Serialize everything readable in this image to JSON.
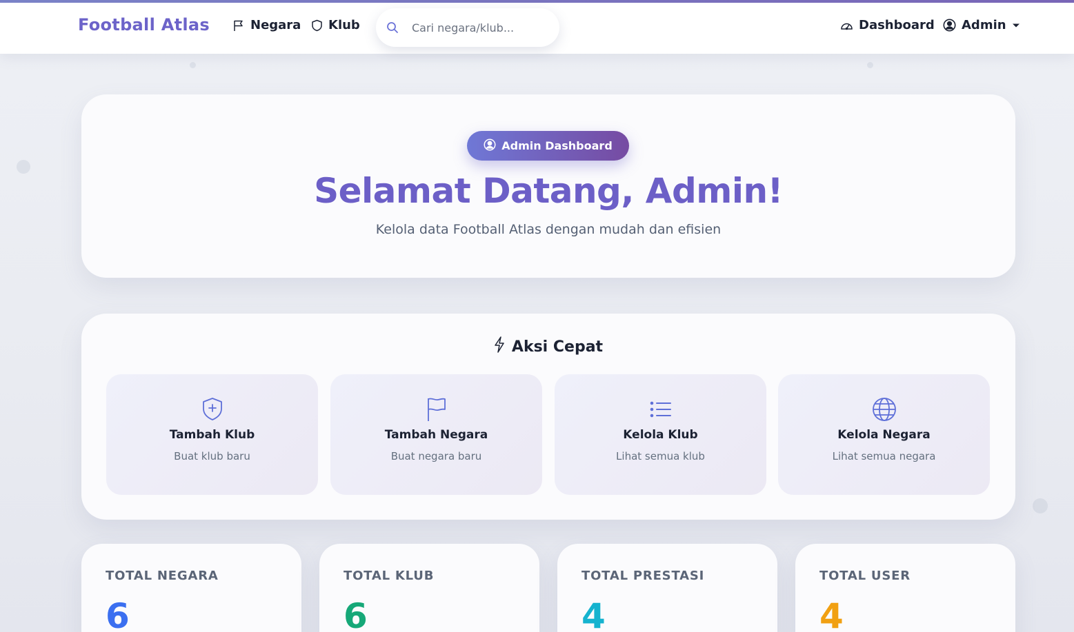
{
  "navbar": {
    "brand": "Football Atlas",
    "links": [
      {
        "label": "Negara",
        "icon": "flag-icon"
      },
      {
        "label": "Klub",
        "icon": "shield-icon"
      }
    ],
    "search_placeholder": "Cari negara/klub...",
    "right": {
      "dashboard_label": "Dashboard",
      "user_label": "Admin"
    }
  },
  "hero": {
    "badge": "Admin Dashboard",
    "title": "Selamat Datang, Admin!",
    "subtitle": "Kelola data Football Atlas dengan mudah dan efisien"
  },
  "quick_actions": {
    "title": "Aksi Cepat",
    "items": [
      {
        "title": "Tambah Klub",
        "subtitle": "Buat klub baru",
        "icon": "shield-plus-icon"
      },
      {
        "title": "Tambah Negara",
        "subtitle": "Buat negara baru",
        "icon": "flag-icon"
      },
      {
        "title": "Kelola Klub",
        "subtitle": "Lihat semua klub",
        "icon": "list-icon"
      },
      {
        "title": "Kelola Negara",
        "subtitle": "Lihat semua negara",
        "icon": "globe-icon"
      }
    ]
  },
  "stats": [
    {
      "label": "TOTAL NEGARA",
      "value": "6",
      "color": "#3b6ff0"
    },
    {
      "label": "TOTAL KLUB",
      "value": "6",
      "color": "#16a878"
    },
    {
      "label": "TOTAL PRESTASI",
      "value": "4",
      "color": "#15b3cf"
    },
    {
      "label": "TOTAL USER",
      "value": "4",
      "color": "#f1a012"
    }
  ],
  "colors": {
    "brand": "#6c63c9",
    "accent_start": "#6f78d6",
    "accent_end": "#764ba2"
  }
}
